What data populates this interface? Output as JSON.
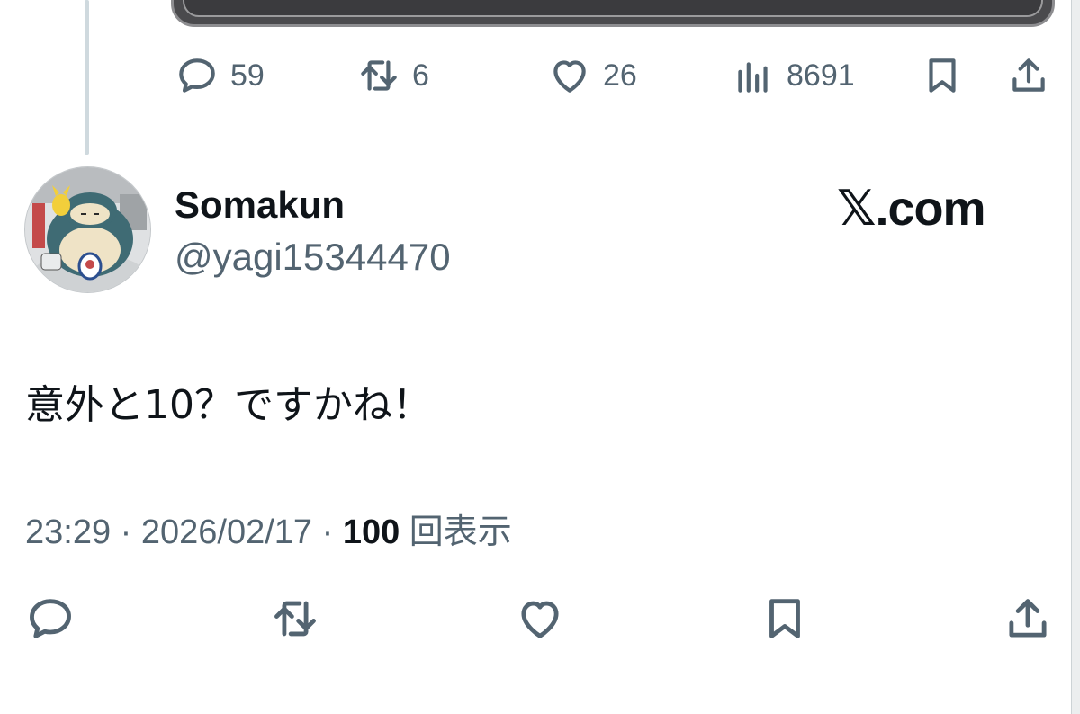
{
  "previous_tweet": {
    "stats": {
      "replies": "59",
      "reposts": "6",
      "likes": "26",
      "views": "8691"
    }
  },
  "tweet": {
    "author_name": "Somakun",
    "author_handle": "@yagi15344470",
    "brand": "𝕏.com",
    "text": "意外と10？ですかね！",
    "time": "23:29",
    "separator": " · ",
    "date": "2026/02/17",
    "views_count": "100",
    "views_label": " 回表示"
  },
  "icons": {
    "reply": "reply-icon",
    "repost": "repost-icon",
    "like": "like-icon",
    "views": "views-chart-icon",
    "bookmark": "bookmark-icon",
    "share": "share-icon"
  },
  "colors": {
    "text_primary": "#0f1419",
    "text_secondary": "#536471",
    "thread_line": "#cfd9de"
  }
}
